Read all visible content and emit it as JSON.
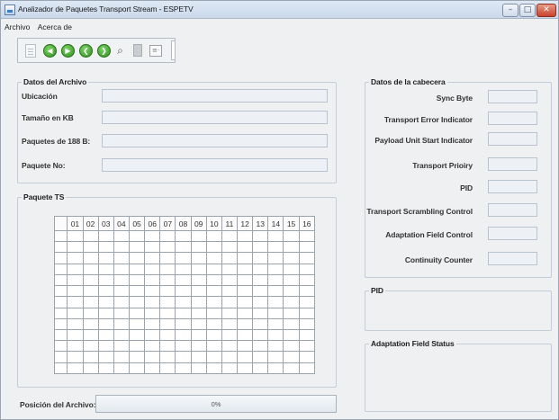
{
  "window": {
    "title": "Analizador de Paquetes Transport Stream - ESPETV",
    "controls": {
      "minimize": "–",
      "maximize": "□",
      "close": "✕"
    }
  },
  "menu": {
    "items": [
      "Archivo",
      "Acerca de"
    ]
  },
  "toolbar": {
    "icons": [
      "document-icon",
      "rewind-icon",
      "play-icon",
      "back-icon",
      "forward-icon",
      "search-icon",
      "clipboard-icon",
      "list-icon"
    ],
    "glyphs": {
      "rewind": "◀",
      "play": "▶",
      "back": "❮",
      "forward": "❯",
      "search": "⌕",
      "list": "≡·"
    }
  },
  "file_data": {
    "title": "Datos del Archivo",
    "fields": [
      {
        "label": "Ubicación",
        "value": ""
      },
      {
        "label": "Tamaño en KB",
        "value": ""
      },
      {
        "label": "Paquetes de 188 B:",
        "value": ""
      },
      {
        "label": "Paquete No:",
        "value": ""
      }
    ]
  },
  "packet": {
    "title": "Paquete TS",
    "columns": [
      "01",
      "02",
      "03",
      "04",
      "05",
      "06",
      "07",
      "08",
      "09",
      "10",
      "11",
      "12",
      "13",
      "14",
      "15",
      "16"
    ]
  },
  "header_data": {
    "title": "Datos de la cabecera",
    "fields": [
      {
        "label": "Sync Byte",
        "value": ""
      },
      {
        "label": "Transport Error Indicator",
        "value": ""
      },
      {
        "label": "Payload Unit Start Indicator",
        "value": ""
      },
      {
        "label": "Transport Prioiry",
        "value": ""
      },
      {
        "label": "PID",
        "value": ""
      },
      {
        "label": "Transport Scrambling Control",
        "value": ""
      },
      {
        "label": "Adaptation Field Control",
        "value": ""
      },
      {
        "label": "Continuity Counter",
        "value": ""
      }
    ]
  },
  "pid_panel": {
    "title": "PID"
  },
  "adaptation_panel": {
    "title": "Adaptation Field Status"
  },
  "progress": {
    "label": "Posición del Archivo:",
    "value": 0,
    "text": "0%"
  },
  "colors": {
    "accent": "#2d8f1b",
    "close_button": "#c8422b"
  }
}
